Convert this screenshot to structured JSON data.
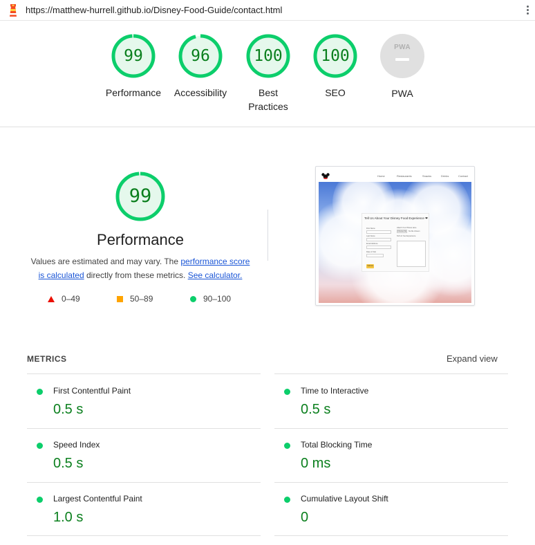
{
  "browser": {
    "url": "https://matthew-hurrell.github.io/Disney-Food-Guide/contact.html",
    "icon": "lighthouse-icon",
    "menu_icon": "more-vert-icon"
  },
  "summary": {
    "categories": [
      {
        "label": "Performance",
        "score": "99",
        "value": 99
      },
      {
        "label": "Accessibility",
        "score": "96",
        "value": 96
      },
      {
        "label_line1": "Best",
        "label_line2": "Practices",
        "score": "100",
        "value": 100
      },
      {
        "label": "SEO",
        "score": "100",
        "value": 100
      }
    ],
    "pwa": {
      "label": "PWA",
      "badge_text": "PWA"
    }
  },
  "performance": {
    "score": "99",
    "value": 99,
    "title": "Performance",
    "desc_prefix": "Values are estimated and may vary. The ",
    "desc_link": "performance score is calculated",
    "desc_middle": " directly from these metrics. ",
    "desc_calc_link": "See calculator.",
    "legend": {
      "fail": "0–49",
      "average": "50–89",
      "pass": "90–100"
    }
  },
  "thumbnail": {
    "nav_links": [
      "Home",
      "Restaurants",
      "Snacks",
      "Drinks",
      "Contact"
    ],
    "form_title": "Tell Us About Your Disney Food Experience ❤",
    "labels": {
      "first_name": "First Name",
      "last_name": "Last Name",
      "email": "Email Address",
      "visit": "Date of Visit",
      "upload": "Attach Your Photos Here",
      "choose_file": "Choose file",
      "no_file": "No file chosen",
      "experience": "Tell Us Your Experience",
      "submit": "Submit"
    }
  },
  "metrics": {
    "heading": "METRICS",
    "expand": "Expand view",
    "items": [
      {
        "name": "First Contentful Paint",
        "value": "0.5 s"
      },
      {
        "name": "Time to Interactive",
        "value": "0.5 s"
      },
      {
        "name": "Speed Index",
        "value": "0.5 s"
      },
      {
        "name": "Total Blocking Time",
        "value": "0 ms"
      },
      {
        "name": "Largest Contentful Paint",
        "value": "1.0 s"
      },
      {
        "name": "Cumulative Layout Shift",
        "value": "0"
      }
    ]
  },
  "colors": {
    "pass": "#0cce6b",
    "pass_text": "#0a7f1d",
    "pass_fill": "#e5f8ec",
    "average": "#ffa400",
    "fail": "#eb0f00",
    "link": "#1a55d6",
    "pwa_gray": "#e0e0e0"
  }
}
